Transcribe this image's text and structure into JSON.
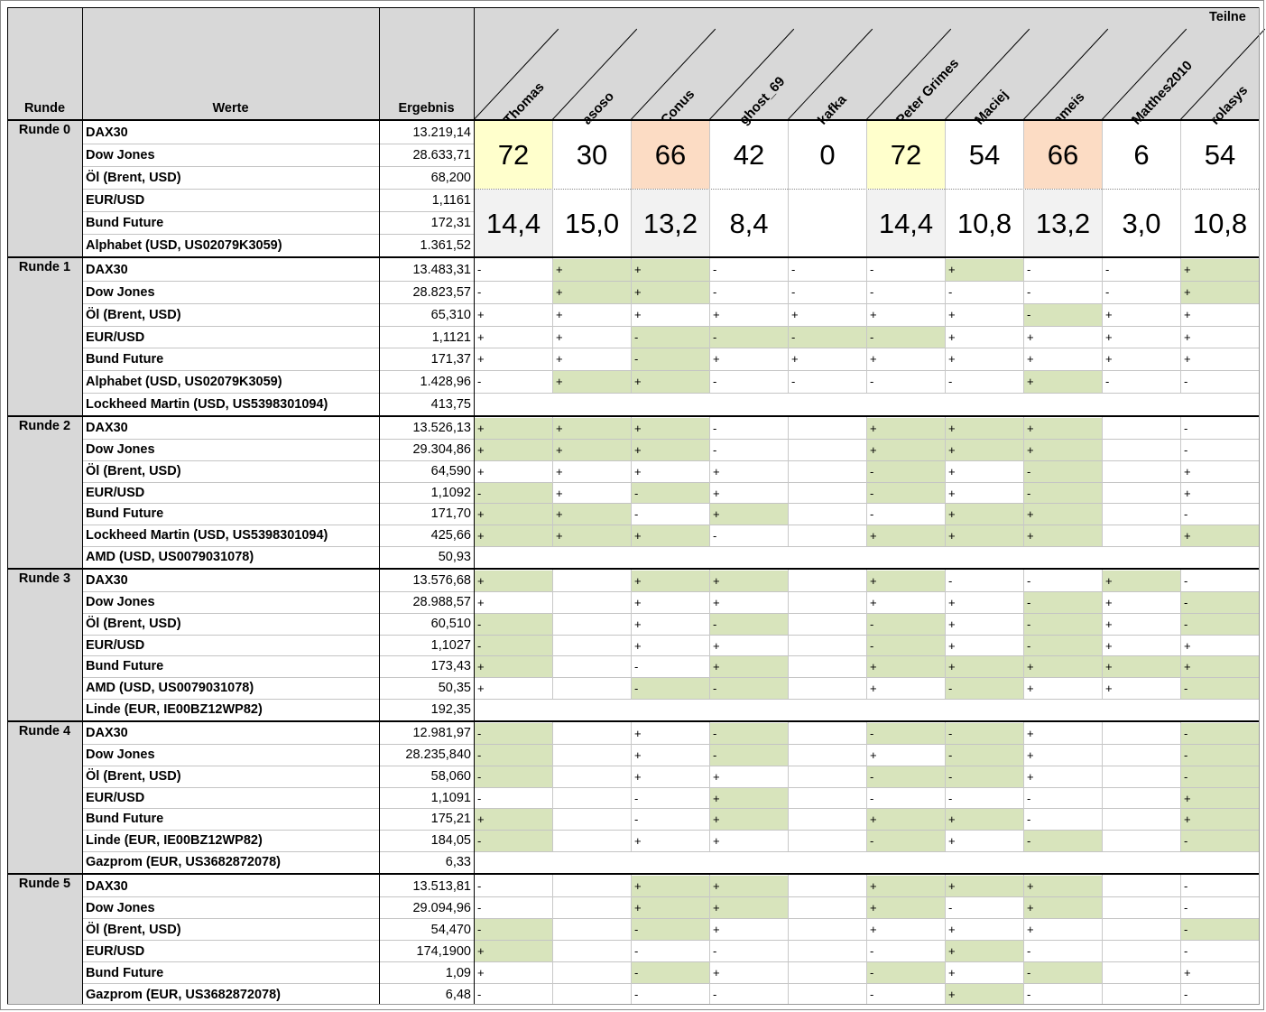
{
  "header": {
    "runde": "Runde",
    "werte": "Werte",
    "ergebnis": "Ergebnis",
    "teilnehmer": "Teilne"
  },
  "participants": [
    "Thomas",
    "asoso",
    "Conus",
    "ghost_69",
    "kafka",
    "Peter Grimes",
    "Maciej",
    "ameis",
    "Matthes2010",
    "rolasys"
  ],
  "summary": {
    "points": [
      "72",
      "30",
      "66",
      "42",
      "0",
      "72",
      "54",
      "66",
      "6",
      "54"
    ],
    "averages": [
      "14,4",
      "15,0",
      "13,2",
      "8,4",
      "",
      "14,4",
      "10,8",
      "13,2",
      "3,0",
      "10,8"
    ],
    "highlight": [
      "yellow",
      "",
      "orange",
      "",
      "",
      "yellow",
      "",
      "orange",
      "",
      ""
    ]
  },
  "colors": {
    "yellow": "#ffffcc",
    "orange": "#fcdcc4",
    "green": "#d8e4bc",
    "header": "#d8d8d8",
    "avg_gray": "#f2f2f2"
  },
  "rounds": [
    {
      "label": "Runde 0",
      "rows": [
        {
          "name": "DAX30",
          "value": "13.219,14"
        },
        {
          "name": "Dow Jones",
          "value": "28.633,71"
        },
        {
          "name": "Öl (Brent, USD)",
          "value": "68,200"
        },
        {
          "name": "EUR/USD",
          "value": "1,1161"
        },
        {
          "name": "Bund Future",
          "value": "172,31"
        },
        {
          "name": "Alphabet (USD, US02079K3059)",
          "value": "1.361,52"
        }
      ]
    },
    {
      "label": "Runde 1",
      "rows": [
        {
          "name": "DAX30",
          "value": "13.483,31",
          "picks": [
            "-",
            "+",
            "+",
            "-",
            "-",
            "-",
            "+",
            "-",
            "-",
            "+"
          ],
          "hits": [
            0,
            1,
            1,
            0,
            0,
            0,
            1,
            0,
            0,
            1
          ]
        },
        {
          "name": "Dow Jones",
          "value": "28.823,57",
          "picks": [
            "-",
            "+",
            "+",
            "-",
            "-",
            "-",
            "-",
            "-",
            "-",
            "+"
          ],
          "hits": [
            0,
            1,
            1,
            0,
            0,
            0,
            0,
            0,
            0,
            1
          ]
        },
        {
          "name": "Öl (Brent, USD)",
          "value": "65,310",
          "picks": [
            "+",
            "+",
            "+",
            "+",
            "+",
            "+",
            "+",
            "-",
            "+",
            "+"
          ],
          "hits": [
            0,
            0,
            0,
            0,
            0,
            0,
            0,
            1,
            0,
            0
          ]
        },
        {
          "name": "EUR/USD",
          "value": "1,1121",
          "picks": [
            "+",
            "+",
            "-",
            "-",
            "-",
            "-",
            "+",
            "+",
            "+",
            "+"
          ],
          "hits": [
            0,
            0,
            1,
            1,
            1,
            1,
            0,
            0,
            0,
            0
          ]
        },
        {
          "name": "Bund Future",
          "value": "171,37",
          "picks": [
            "+",
            "+",
            "-",
            "+",
            "+",
            "+",
            "+",
            "+",
            "+",
            "+"
          ],
          "hits": [
            0,
            0,
            1,
            0,
            0,
            0,
            0,
            0,
            0,
            0
          ]
        },
        {
          "name": "Alphabet (USD, US02079K3059)",
          "value": "1.428,96",
          "picks": [
            "-",
            "+",
            "+",
            "-",
            "-",
            "-",
            "-",
            "+",
            "-",
            "-"
          ],
          "hits": [
            0,
            1,
            1,
            0,
            0,
            0,
            0,
            1,
            0,
            0
          ]
        },
        {
          "name": "Lockheed Martin (USD, US5398301094)",
          "value": "413,75"
        }
      ]
    },
    {
      "label": "Runde 2",
      "rows": [
        {
          "name": "DAX30",
          "value": "13.526,13",
          "picks": [
            "+",
            "+",
            "+",
            "-",
            "",
            "+",
            "+",
            "+",
            "",
            "-"
          ],
          "hits": [
            1,
            1,
            1,
            0,
            0,
            1,
            1,
            1,
            0,
            0
          ]
        },
        {
          "name": "Dow Jones",
          "value": "29.304,86",
          "picks": [
            "+",
            "+",
            "+",
            "-",
            "",
            "+",
            "+",
            "+",
            "",
            "-"
          ],
          "hits": [
            1,
            1,
            1,
            0,
            0,
            1,
            1,
            1,
            0,
            0
          ]
        },
        {
          "name": "Öl (Brent, USD)",
          "value": "64,590",
          "picks": [
            "+",
            "+",
            "+",
            "+",
            "",
            "-",
            "+",
            "-",
            "",
            "+"
          ],
          "hits": [
            0,
            0,
            0,
            0,
            0,
            1,
            0,
            1,
            0,
            0
          ]
        },
        {
          "name": "EUR/USD",
          "value": "1,1092",
          "picks": [
            "-",
            "+",
            "-",
            "+",
            "",
            "-",
            "+",
            "-",
            "",
            "+"
          ],
          "hits": [
            1,
            0,
            1,
            0,
            0,
            1,
            0,
            1,
            0,
            0
          ]
        },
        {
          "name": "Bund Future",
          "value": "171,70",
          "picks": [
            "+",
            "+",
            "-",
            "+",
            "",
            "-",
            "+",
            "+",
            "",
            "-"
          ],
          "hits": [
            1,
            1,
            0,
            1,
            0,
            0,
            1,
            1,
            0,
            0
          ]
        },
        {
          "name": "Lockheed Martin (USD, US5398301094)",
          "value": "425,66",
          "picks": [
            "+",
            "+",
            "+",
            "-",
            "",
            "+",
            "+",
            "+",
            "",
            "+"
          ],
          "hits": [
            1,
            1,
            1,
            0,
            0,
            1,
            1,
            1,
            0,
            1
          ]
        },
        {
          "name": "AMD (USD, US0079031078)",
          "value": "50,93"
        }
      ]
    },
    {
      "label": "Runde 3",
      "rows": [
        {
          "name": "DAX30",
          "value": "13.576,68",
          "picks": [
            "+",
            "",
            "+",
            "+",
            "",
            "+",
            "-",
            "-",
            "+",
            "-"
          ],
          "hits": [
            1,
            0,
            1,
            1,
            0,
            1,
            0,
            0,
            1,
            0
          ]
        },
        {
          "name": "Dow Jones",
          "value": "28.988,57",
          "picks": [
            "+",
            "",
            "+",
            "+",
            "",
            "+",
            "+",
            "-",
            "+",
            "-"
          ],
          "hits": [
            0,
            0,
            0,
            0,
            0,
            0,
            0,
            1,
            0,
            1
          ]
        },
        {
          "name": "Öl (Brent, USD)",
          "value": "60,510",
          "picks": [
            "-",
            "",
            "+",
            "-",
            "",
            "-",
            "+",
            "-",
            "+",
            "-"
          ],
          "hits": [
            1,
            0,
            0,
            1,
            0,
            1,
            0,
            1,
            0,
            1
          ]
        },
        {
          "name": "EUR/USD",
          "value": "1,1027",
          "picks": [
            "-",
            "",
            "+",
            "+",
            "",
            "-",
            "+",
            "-",
            "+",
            "+"
          ],
          "hits": [
            1,
            0,
            0,
            0,
            0,
            1,
            0,
            1,
            0,
            0
          ]
        },
        {
          "name": "Bund Future",
          "value": "173,43",
          "picks": [
            "+",
            "",
            "-",
            "+",
            "",
            "+",
            "+",
            "+",
            "+",
            "+"
          ],
          "hits": [
            1,
            0,
            0,
            1,
            0,
            1,
            1,
            1,
            1,
            1
          ]
        },
        {
          "name": "AMD (USD, US0079031078)",
          "value": "50,35",
          "picks": [
            "+",
            "",
            "-",
            "-",
            "",
            "+",
            "-",
            "+",
            "+",
            "-"
          ],
          "hits": [
            0,
            0,
            1,
            1,
            0,
            0,
            1,
            0,
            0,
            1
          ]
        },
        {
          "name": "Linde (EUR, IE00BZ12WP82)",
          "value": "192,35"
        }
      ]
    },
    {
      "label": "Runde 4",
      "rows": [
        {
          "name": "DAX30",
          "value": "12.981,97",
          "picks": [
            "-",
            "",
            "+",
            "-",
            "",
            "-",
            "-",
            "+",
            "",
            "-"
          ],
          "hits": [
            1,
            0,
            0,
            1,
            0,
            1,
            1,
            0,
            0,
            1
          ]
        },
        {
          "name": "Dow Jones",
          "value": "28.235,840",
          "picks": [
            "-",
            "",
            "+",
            "-",
            "",
            "+",
            "-",
            "+",
            "",
            "-"
          ],
          "hits": [
            1,
            0,
            0,
            1,
            0,
            0,
            1,
            0,
            0,
            1
          ]
        },
        {
          "name": "Öl (Brent, USD)",
          "value": "58,060",
          "picks": [
            "-",
            "",
            "+",
            "+",
            "",
            "-",
            "-",
            "+",
            "",
            "-"
          ],
          "hits": [
            1,
            0,
            0,
            0,
            0,
            1,
            1,
            0,
            0,
            1
          ]
        },
        {
          "name": "EUR/USD",
          "value": "1,1091",
          "picks": [
            "-",
            "",
            "-",
            "+",
            "",
            "-",
            "-",
            "-",
            "",
            "+"
          ],
          "hits": [
            0,
            0,
            0,
            1,
            0,
            0,
            0,
            0,
            0,
            1
          ]
        },
        {
          "name": "Bund Future",
          "value": "175,21",
          "picks": [
            "+",
            "",
            "-",
            "+",
            "",
            "+",
            "+",
            "-",
            "",
            "+"
          ],
          "hits": [
            1,
            0,
            0,
            1,
            0,
            1,
            1,
            0,
            0,
            1
          ]
        },
        {
          "name": "Linde (EUR, IE00BZ12WP82)",
          "value": "184,05",
          "picks": [
            "-",
            "",
            "+",
            "+",
            "",
            "-",
            "+",
            "-",
            "",
            "-"
          ],
          "hits": [
            1,
            0,
            0,
            0,
            0,
            1,
            0,
            1,
            0,
            1
          ]
        },
        {
          "name": "Gazprom (EUR, US3682872078)",
          "value": "6,33"
        }
      ]
    },
    {
      "label": "Runde 5",
      "rows": [
        {
          "name": "DAX30",
          "value": "13.513,81",
          "picks": [
            "-",
            "",
            "+",
            "+",
            "",
            "+",
            "+",
            "+",
            "",
            "-"
          ],
          "hits": [
            0,
            0,
            1,
            1,
            0,
            1,
            1,
            1,
            0,
            0
          ]
        },
        {
          "name": "Dow Jones",
          "value": "29.094,96",
          "picks": [
            "-",
            "",
            "+",
            "+",
            "",
            "+",
            "-",
            "+",
            "",
            "-"
          ],
          "hits": [
            0,
            0,
            1,
            1,
            0,
            1,
            0,
            1,
            0,
            0
          ]
        },
        {
          "name": "Öl (Brent, USD)",
          "value": "54,470",
          "picks": [
            "-",
            "",
            "-",
            "+",
            "",
            "+",
            "+",
            "+",
            "",
            "-"
          ],
          "hits": [
            1,
            0,
            1,
            0,
            0,
            0,
            0,
            0,
            0,
            1
          ]
        },
        {
          "name": "EUR/USD",
          "value": "174,1900",
          "picks": [
            "+",
            "",
            "-",
            "-",
            "",
            "-",
            "+",
            "-",
            "",
            "-"
          ],
          "hits": [
            1,
            0,
            0,
            0,
            0,
            0,
            1,
            0,
            0,
            0
          ]
        },
        {
          "name": "Bund Future",
          "value": "1,09",
          "picks": [
            "+",
            "",
            "-",
            "+",
            "",
            "-",
            "+",
            "-",
            "",
            "+"
          ],
          "hits": [
            0,
            0,
            1,
            0,
            0,
            1,
            0,
            1,
            0,
            0
          ]
        },
        {
          "name": "Gazprom (EUR, US3682872078)",
          "value": "6,48",
          "picks": [
            "-",
            "",
            "-",
            "-",
            "",
            "-",
            "+",
            "-",
            "",
            "-"
          ],
          "hits": [
            0,
            0,
            0,
            0,
            0,
            0,
            1,
            0,
            0,
            0
          ]
        }
      ]
    }
  ]
}
